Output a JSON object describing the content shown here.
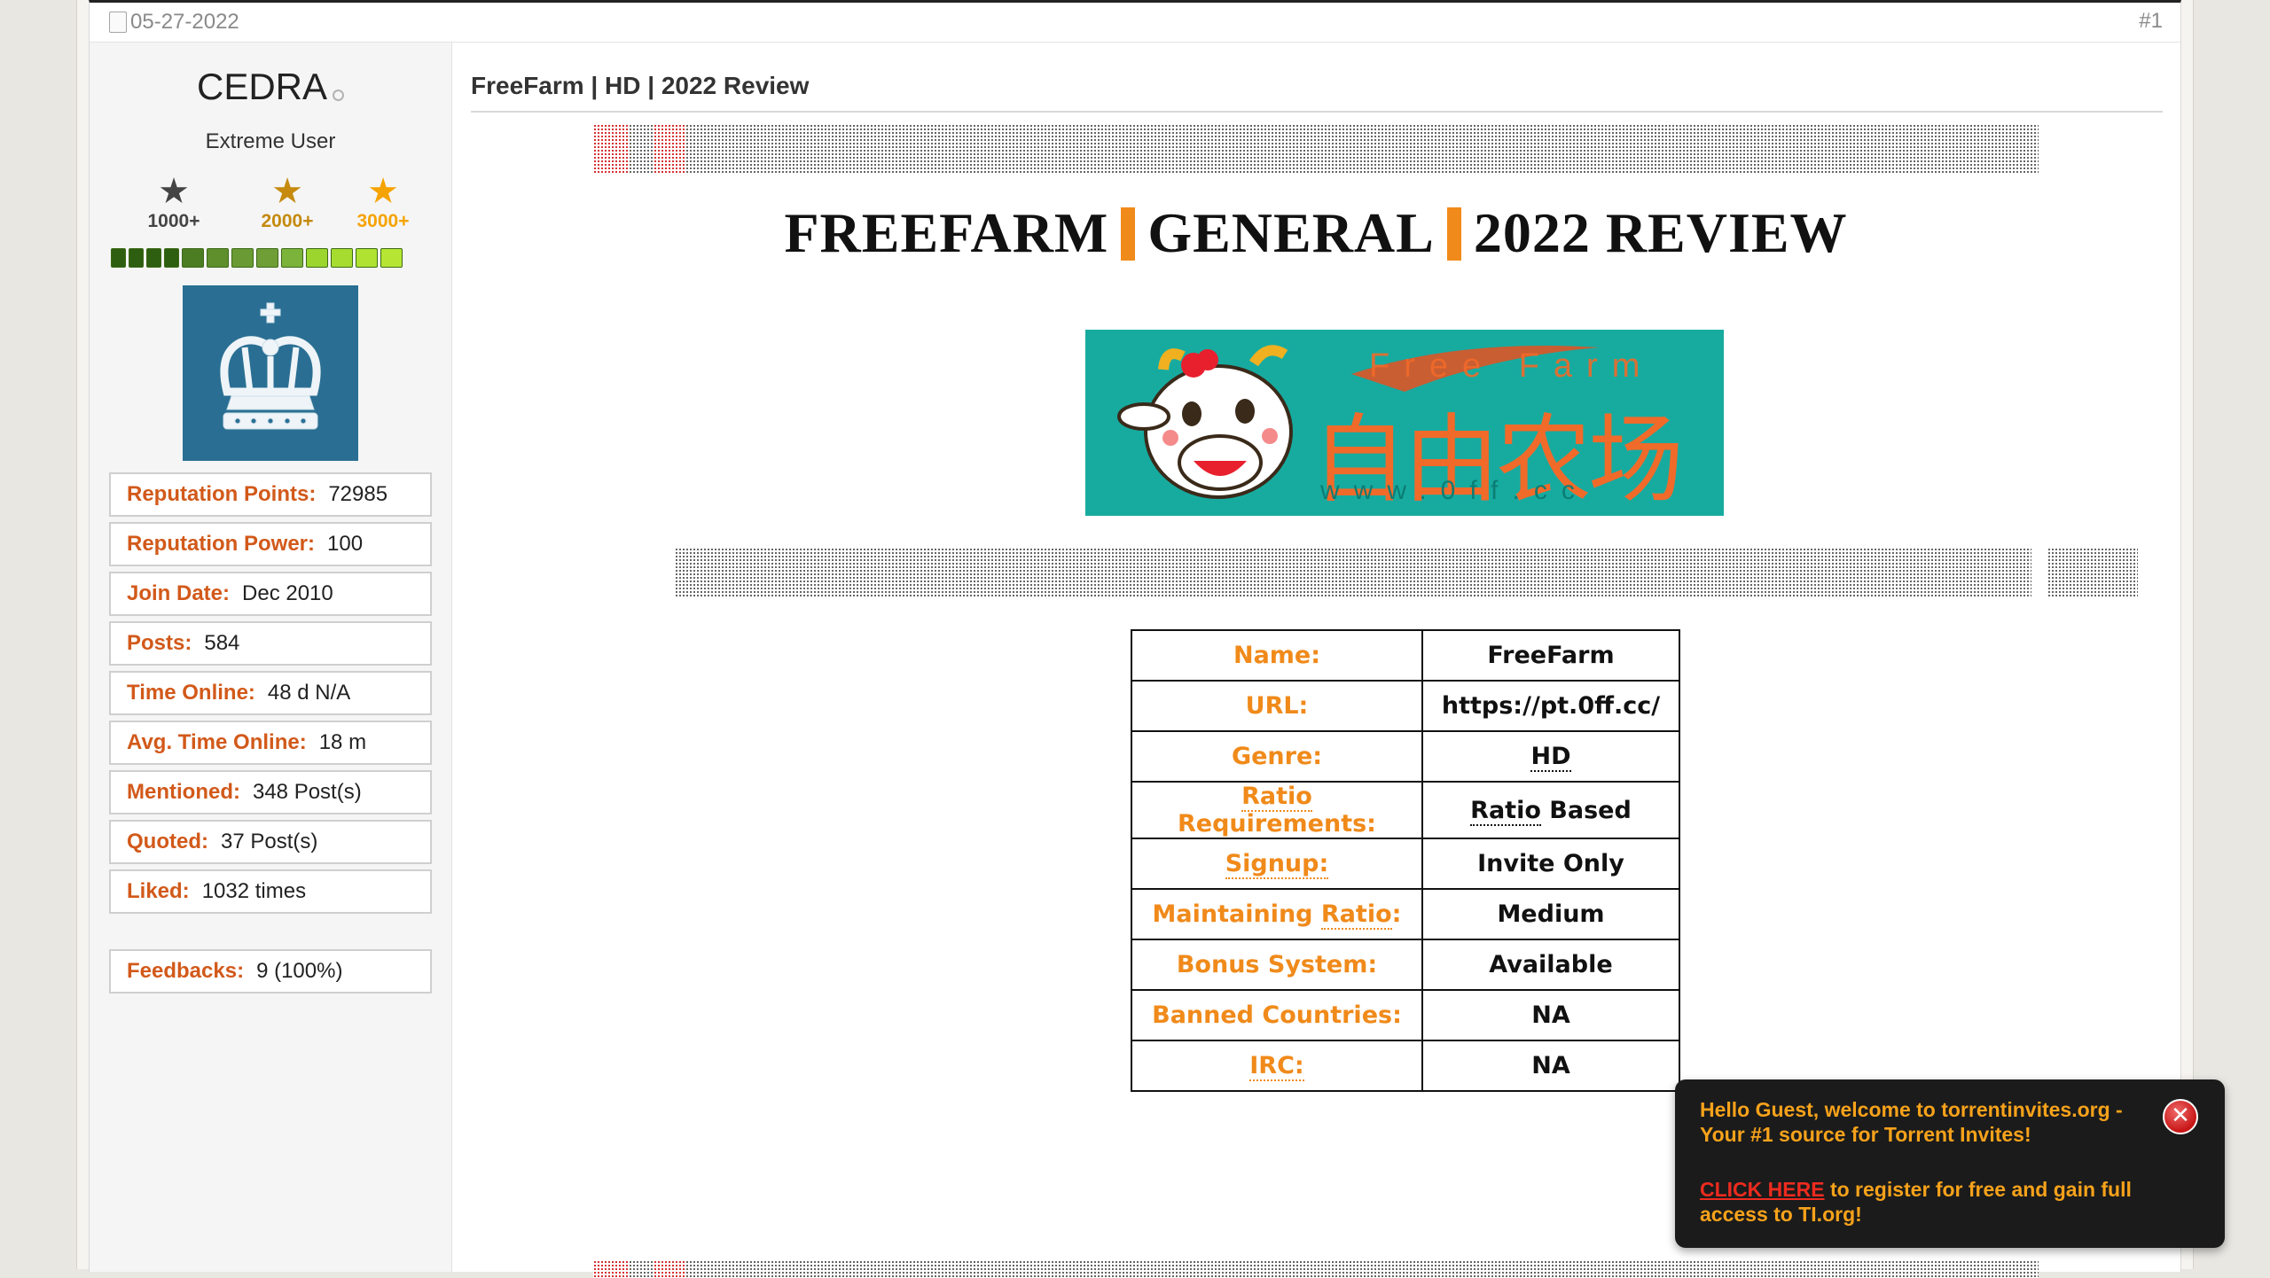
{
  "post": {
    "date": "05-27-2022",
    "number": "#1"
  },
  "user": {
    "name": "CEDRA",
    "title": "Extreme User",
    "stars": [
      {
        "label": "1000+",
        "color": "#444444"
      },
      {
        "label": "2000+",
        "color": "#c58a0e"
      },
      {
        "label": "3000+",
        "color": "#f5a300"
      }
    ],
    "stats": [
      {
        "label": "Reputation Points:",
        "value": "72985"
      },
      {
        "label": "Reputation Power:",
        "value": "100"
      },
      {
        "label": "Join Date:",
        "value": "Dec 2010"
      },
      {
        "label": "Posts:",
        "value": "584"
      },
      {
        "label": "Time Online:",
        "value": "48 d N/A"
      },
      {
        "label": "Avg. Time Online:",
        "value": "18 m"
      },
      {
        "label": "Mentioned:",
        "value": "348 Post(s)"
      },
      {
        "label": "Quoted:",
        "value": "37 Post(s)"
      },
      {
        "label": "Liked:",
        "value": "1032 times"
      }
    ],
    "feedback": {
      "label": "Feedbacks:",
      "value": "9 (100%)"
    }
  },
  "content": {
    "title": "FreeFarm | HD | 2022 Review",
    "heading": {
      "part1": "FREEFARM",
      "part2": "GENERAL",
      "part3": "2022 REVIEW"
    },
    "banner": {
      "chinese": "自由农场",
      "english": "Free Farm",
      "url": "www.0ff.cc"
    },
    "info_rows": [
      {
        "label": "Name:",
        "value": "FreeFarm"
      },
      {
        "label": "URL:",
        "value": "https://pt.0ff.cc/"
      },
      {
        "label": "Genre:",
        "value": "HD"
      },
      {
        "label": "Ratio Requirements:",
        "value": "Ratio Based"
      },
      {
        "label": "Signup:",
        "value": "Invite Only"
      },
      {
        "label": "Maintaining Ratio:",
        "value": "Medium"
      },
      {
        "label": "Bonus System:",
        "value": "Available"
      },
      {
        "label": "Banned Countries:",
        "value": "NA"
      },
      {
        "label": "IRC:",
        "value": "NA"
      }
    ]
  },
  "popup": {
    "greeting": "Hello Guest, welcome to torrentinvites.org - Your #1 source for Torrent Invites!",
    "link_text": "CLICK HERE",
    "cta_rest": " to register for free and gain full access to TI.org!"
  },
  "colors": {
    "accent_orange": "#f08a1a",
    "label_orange": "#d2591a",
    "popup_bg": "#1b1b1b",
    "banner_teal": "#17aba0"
  }
}
